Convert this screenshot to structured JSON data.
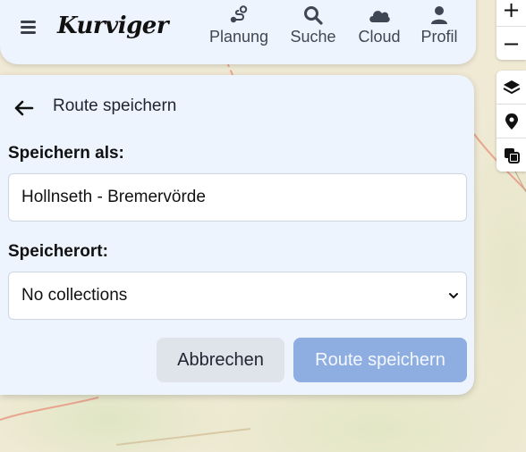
{
  "header": {
    "logo_text": "Kurviger",
    "menu_icon": "hamburger-menu-icon",
    "nav": [
      {
        "label": "Planung",
        "icon": "route-planning-icon"
      },
      {
        "label": "Suche",
        "icon": "search-icon"
      },
      {
        "label": "Cloud",
        "icon": "cloud-icon"
      },
      {
        "label": "Profil",
        "icon": "user-icon"
      }
    ]
  },
  "map_controls": {
    "zoom_in": "+",
    "zoom_out": "−",
    "tools": [
      "layers-icon",
      "location-pin-icon",
      "overlay-copy-icon"
    ]
  },
  "dialog": {
    "title": "Route speichern",
    "save_as_label": "Speichern als:",
    "save_as_value": "Hollnseth - Bremervörde",
    "location_label": "Speicherort:",
    "location_selected": "No collections",
    "cancel_label": "Abbrechen",
    "save_label": "Route speichern"
  },
  "colors": {
    "panel_bg": "#eef4fd",
    "save_button": "#8eaee2",
    "cancel_button": "#dfe3ea",
    "map_bg": "#f0ead5",
    "route_line": "#e8a58f"
  }
}
